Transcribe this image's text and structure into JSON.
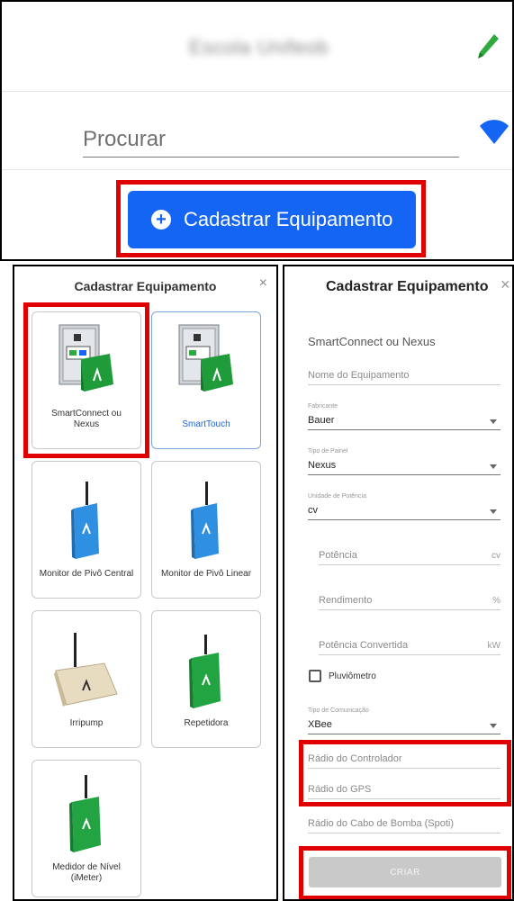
{
  "top": {
    "school_name": "Escola Unifeob",
    "search_placeholder": "Procurar",
    "register_button": "Cadastrar Equipamento"
  },
  "left_dialog": {
    "title": "Cadastrar Equipamento",
    "close": "×",
    "cards": [
      {
        "label": "SmartConnect ou\nNexus"
      },
      {
        "label": "SmartTouch"
      },
      {
        "label": "Monitor de Pivô Central"
      },
      {
        "label": "Monitor de Pivô Linear"
      },
      {
        "label": "Irripump"
      },
      {
        "label": "Repetidora"
      },
      {
        "label": "Medidor de Nível\n(iMeter)"
      }
    ]
  },
  "right_dialog": {
    "title": "Cadastrar Equipamento",
    "close": "×",
    "subtitle": "SmartConnect ou Nexus",
    "equipment_name_placeholder": "Nome do Equipamento",
    "fabricante_label": "Fabricante",
    "fabricante_value": "Bauer",
    "painel_label": "Tipo de Painel",
    "painel_value": "Nexus",
    "unidade_label": "Unidade de Potência",
    "unidade_value": "cv",
    "potencia_placeholder": "Potência",
    "potencia_unit": "cv",
    "rendimento_placeholder": "Rendimento",
    "rendimento_unit": "%",
    "convertida_placeholder": "Potência Convertida",
    "convertida_unit": "kW",
    "pluviometro_label": "Pluviômetro",
    "comunicacao_label": "Tipo de Comunicação",
    "comunicacao_value": "XBee",
    "radio_controlador_placeholder": "Rádio do Controlador",
    "radio_gps_placeholder": "Rádio do GPS",
    "radio_bomba_placeholder": "Rádio do Cabo de Bomba (Spoti)",
    "submit_label": "CRIAR"
  },
  "colors": {
    "primary": "#1565f5",
    "highlight": "#e00000",
    "pencil": "#2faa3f",
    "disabled": "#c9c9c9"
  }
}
